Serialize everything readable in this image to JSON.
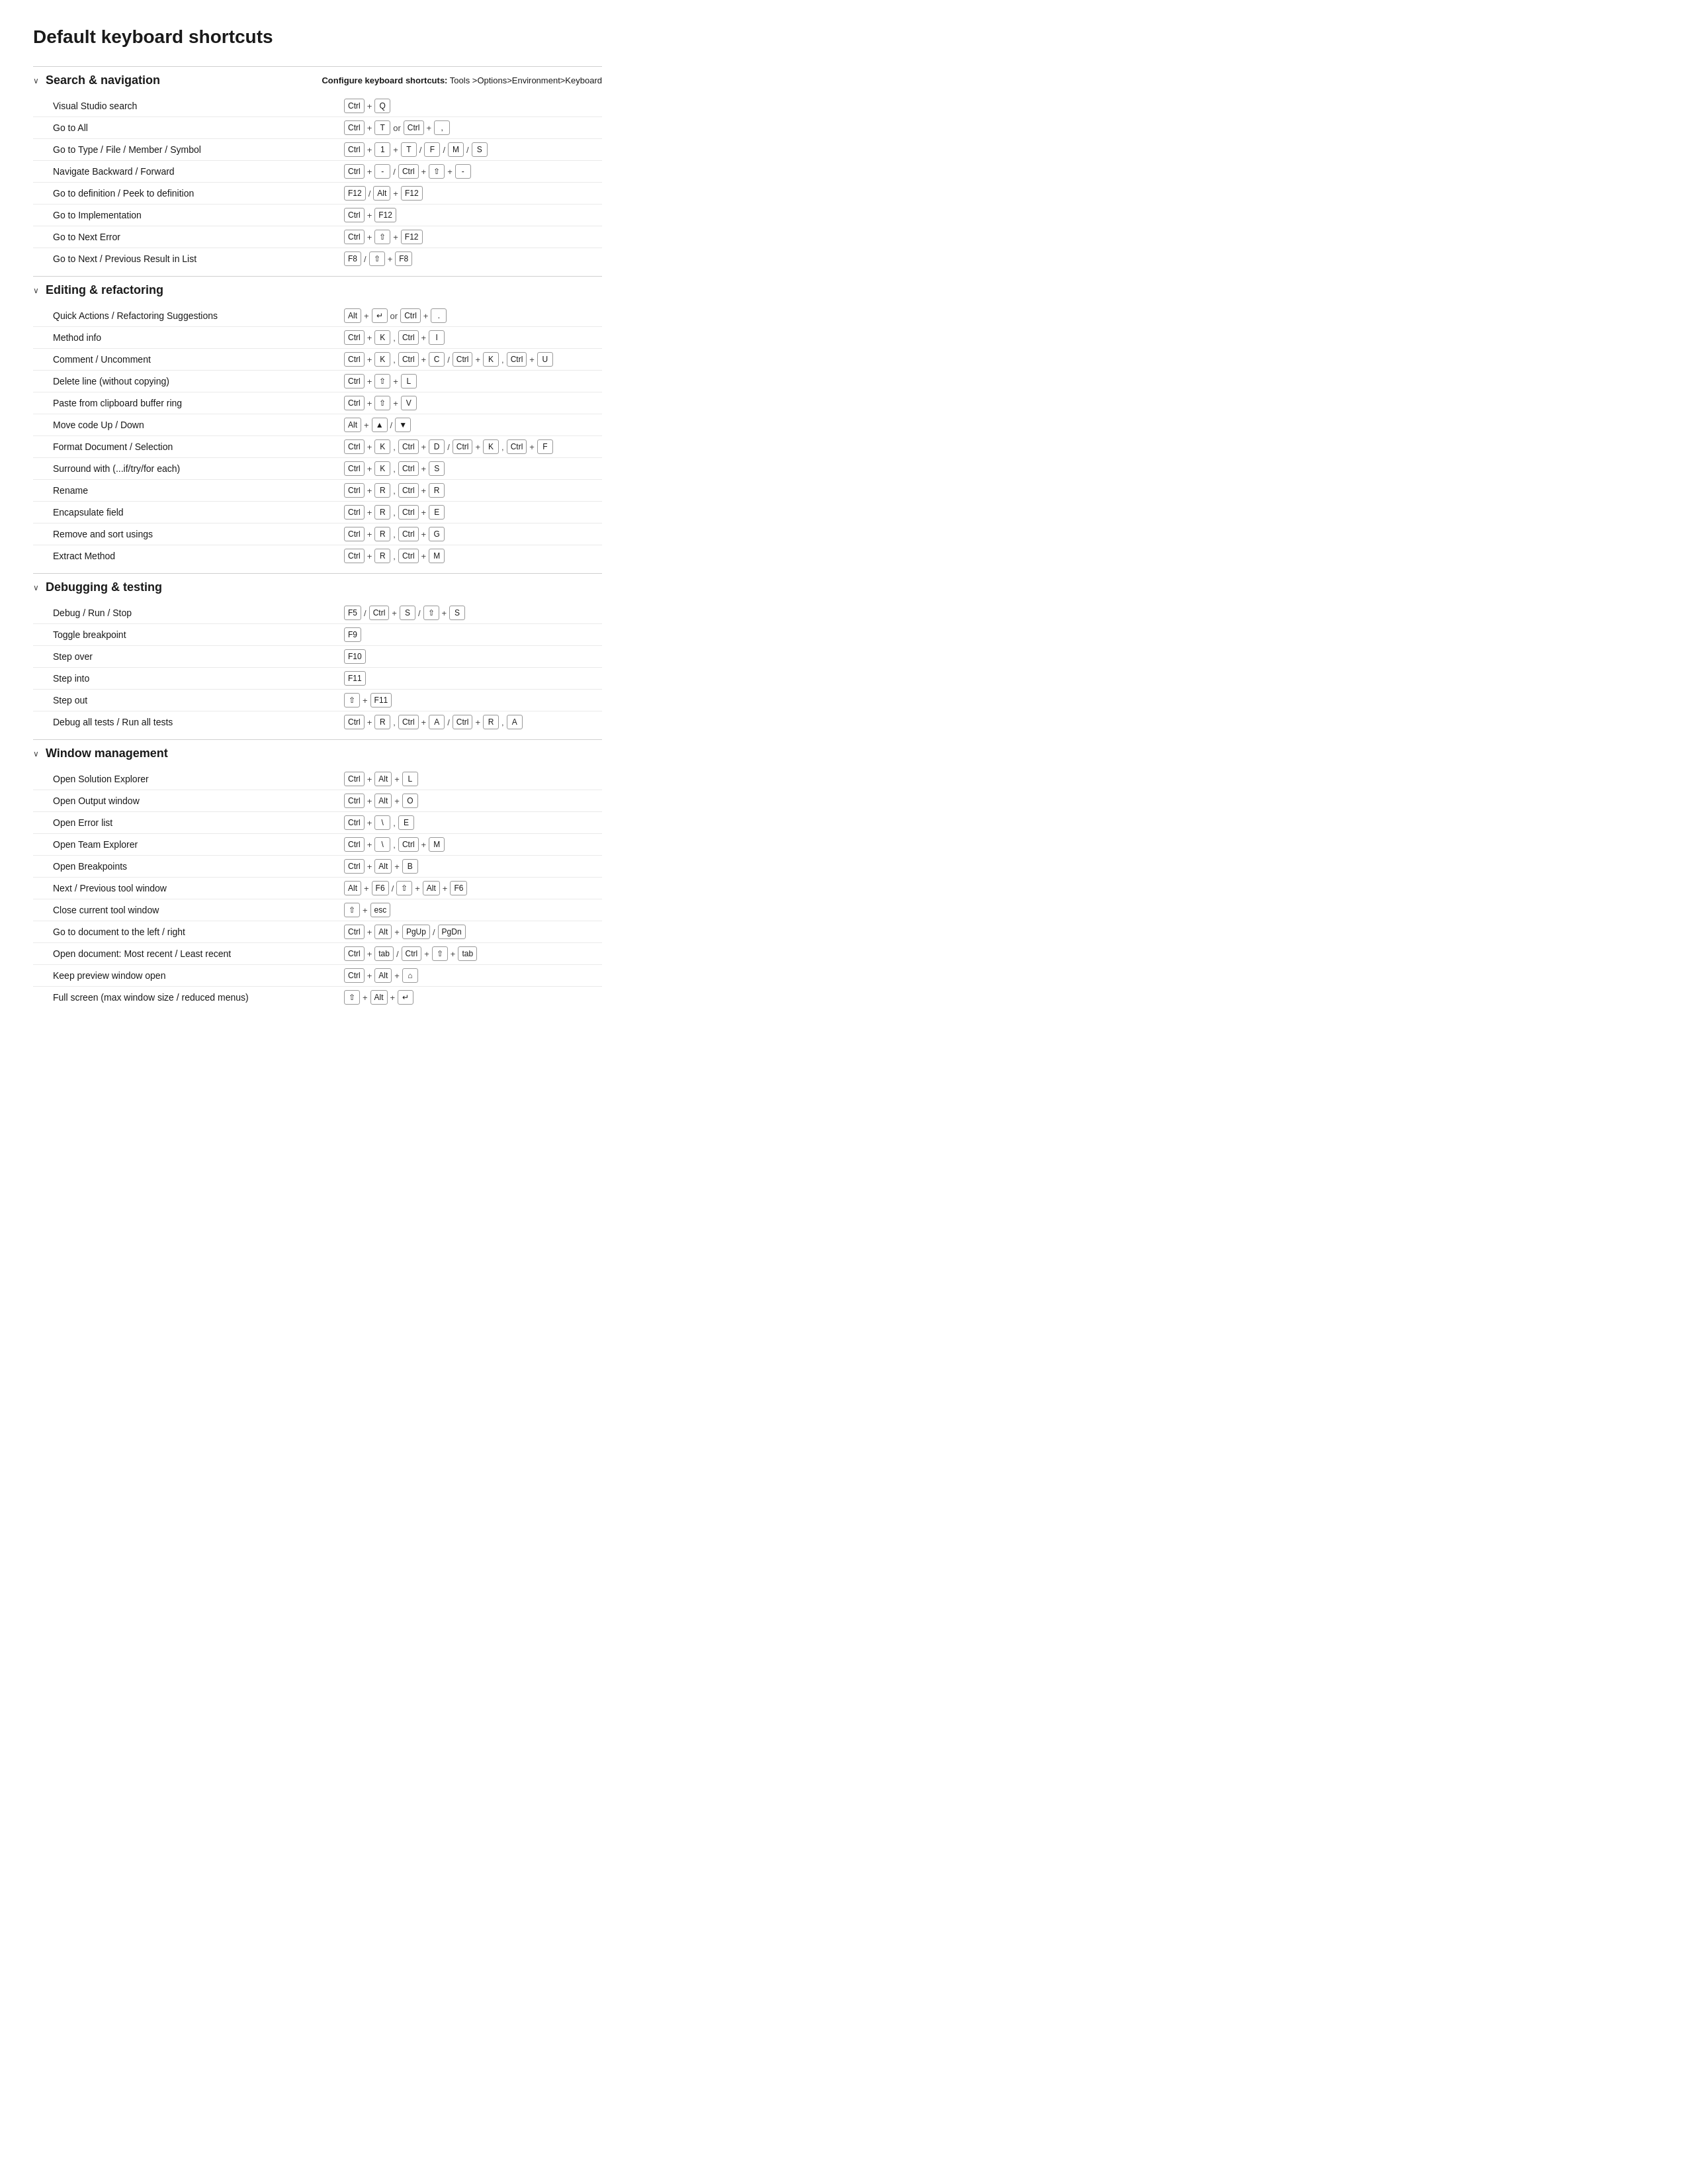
{
  "page": {
    "title": "Default keyboard shortcuts"
  },
  "sections": [
    {
      "id": "search-navigation",
      "label": "Search & navigation",
      "configure_note": "Configure keyboard shortcuts: Tools >Options>Environment>Keyboard",
      "rows": [
        {
          "label": "Visual Studio search",
          "keys_html": "<kbd>Ctrl</kbd><span class='sep'>+</span><kbd>Q</kbd>"
        },
        {
          "label": "Go to All",
          "keys_html": "<kbd>Ctrl</kbd><span class='sep'>+</span><kbd>T</kbd><span class='sep'>or</span><kbd>Ctrl</kbd><span class='sep'>+</span><kbd>,</kbd>"
        },
        {
          "label": "Go to Type / File / Member / Symbol",
          "keys_html": "<kbd>Ctrl</kbd><span class='sep'>+</span><kbd>1</kbd><span class='sep'>+</span><kbd>T</kbd><span class='sep'>/</span><kbd>F</kbd><span class='sep'>/</span><kbd>M</kbd><span class='sep'>/</span><kbd>S</kbd>"
        },
        {
          "label": "Navigate Backward / Forward",
          "keys_html": "<kbd>Ctrl</kbd><span class='sep'>+</span><kbd>-</kbd><span class='sep'>/</span><kbd>Ctrl</kbd><span class='sep'>+</span><kbd>⇧</kbd><span class='sep'>+</span><kbd>-</kbd>"
        },
        {
          "label": "Go to definition / Peek to definition",
          "keys_html": "<kbd>F12</kbd><span class='sep'>/</span><kbd>Alt</kbd><span class='sep'>+</span><kbd>F12</kbd>"
        },
        {
          "label": "Go to Implementation",
          "keys_html": "<kbd>Ctrl</kbd><span class='sep'>+</span><kbd>F12</kbd>"
        },
        {
          "label": "Go to Next Error",
          "keys_html": "<kbd>Ctrl</kbd><span class='sep'>+</span><kbd>⇧</kbd><span class='sep'>+</span><kbd>F12</kbd>"
        },
        {
          "label": "Go to Next / Previous Result in List",
          "keys_html": "<kbd>F8</kbd><span class='sep'>/</span><kbd>⇧</kbd><span class='sep'>+</span><kbd>F8</kbd>"
        }
      ]
    },
    {
      "id": "editing-refactoring",
      "label": "Editing & refactoring",
      "configure_note": "",
      "rows": [
        {
          "label": "Quick Actions / Refactoring Suggestions",
          "keys_html": "<kbd>Alt</kbd><span class='sep'>+</span><kbd>↵</kbd><span class='sep'>or</span><kbd>Ctrl</kbd><span class='sep'>+</span><kbd>.</kbd>"
        },
        {
          "label": "Method info",
          "keys_html": "<kbd>Ctrl</kbd><span class='sep'>+</span><kbd>K</kbd><span class='sep'>,</span><kbd>Ctrl</kbd><span class='sep'>+</span><kbd>I</kbd>"
        },
        {
          "label": "Comment / Uncomment",
          "keys_html": "<kbd>Ctrl</kbd><span class='sep'>+</span><kbd>K</kbd><span class='sep'>,</span><kbd>Ctrl</kbd><span class='sep'>+</span><kbd>C</kbd><span class='sep'>/</span><kbd>Ctrl</kbd><span class='sep'>+</span><kbd>K</kbd><span class='sep'>,</span><kbd>Ctrl</kbd><span class='sep'>+</span><kbd>U</kbd>"
        },
        {
          "label": "Delete line (without copying)",
          "keys_html": "<kbd>Ctrl</kbd><span class='sep'>+</span><kbd>⇧</kbd><span class='sep'>+</span><kbd>L</kbd>"
        },
        {
          "label": "Paste from clipboard buffer ring",
          "keys_html": "<kbd>Ctrl</kbd><span class='sep'>+</span><kbd>⇧</kbd><span class='sep'>+</span><kbd>V</kbd>"
        },
        {
          "label": "Move code Up / Down",
          "keys_html": "<kbd>Alt</kbd><span class='sep'>+</span><kbd>▲</kbd><span class='sep'>/</span><kbd>▼</kbd>"
        },
        {
          "label": "Format Document / Selection",
          "keys_html": "<kbd>Ctrl</kbd><span class='sep'>+</span><kbd>K</kbd><span class='sep'>,</span><kbd>Ctrl</kbd><span class='sep'>+</span><kbd>D</kbd><span class='sep'>/</span><kbd>Ctrl</kbd><span class='sep'>+</span><kbd>K</kbd><span class='sep'>,</span><kbd>Ctrl</kbd><span class='sep'>+</span><kbd>F</kbd>"
        },
        {
          "label": "Surround with (...if/try/for each)",
          "keys_html": "<kbd>Ctrl</kbd><span class='sep'>+</span><kbd>K</kbd><span class='sep'>,</span><kbd>Ctrl</kbd><span class='sep'>+</span><kbd>S</kbd>"
        },
        {
          "label": "Rename",
          "keys_html": "<kbd>Ctrl</kbd><span class='sep'>+</span><kbd>R</kbd><span class='sep'>,</span><kbd>Ctrl</kbd><span class='sep'>+</span><kbd>R</kbd>"
        },
        {
          "label": "Encapsulate field",
          "keys_html": "<kbd>Ctrl</kbd><span class='sep'>+</span><kbd>R</kbd><span class='sep'>,</span><kbd>Ctrl</kbd><span class='sep'>+</span><kbd>E</kbd>"
        },
        {
          "label": "Remove and sort usings",
          "keys_html": "<kbd>Ctrl</kbd><span class='sep'>+</span><kbd>R</kbd><span class='sep'>,</span><kbd>Ctrl</kbd><span class='sep'>+</span><kbd>G</kbd>"
        },
        {
          "label": "Extract Method",
          "keys_html": "<kbd>Ctrl</kbd><span class='sep'>+</span><kbd>R</kbd><span class='sep'>,</span><kbd>Ctrl</kbd><span class='sep'>+</span><kbd>M</kbd>"
        }
      ]
    },
    {
      "id": "debugging-testing",
      "label": "Debugging & testing",
      "configure_note": "",
      "rows": [
        {
          "label": "Debug / Run / Stop",
          "keys_html": "<kbd>F5</kbd><span class='sep'>/</span><kbd>Ctrl</kbd><span class='sep'>+</span><kbd>S</kbd><span class='sep'>/</span><kbd>⇧</kbd><span class='sep'>+</span><kbd>S</kbd>"
        },
        {
          "label": "Toggle breakpoint",
          "keys_html": "<kbd>F9</kbd>"
        },
        {
          "label": "Step over",
          "keys_html": "<kbd>F10</kbd>"
        },
        {
          "label": "Step into",
          "keys_html": "<kbd>F11</kbd>"
        },
        {
          "label": "Step out",
          "keys_html": "<kbd>⇧</kbd><span class='sep'>+</span><kbd>F11</kbd>"
        },
        {
          "label": "Debug all tests / Run all tests",
          "keys_html": "<kbd>Ctrl</kbd><span class='sep'>+</span><kbd>R</kbd><span class='sep'>,</span><kbd>Ctrl</kbd><span class='sep'>+</span><kbd>A</kbd><span class='sep'>/</span><kbd>Ctrl</kbd><span class='sep'>+</span><kbd>R</kbd><span class='sep'>,</span><kbd>A</kbd>"
        }
      ]
    },
    {
      "id": "window-management",
      "label": "Window management",
      "configure_note": "",
      "rows": [
        {
          "label": "Open Solution Explorer",
          "keys_html": "<kbd>Ctrl</kbd><span class='sep'>+</span><kbd>Alt</kbd><span class='sep'>+</span><kbd>L</kbd>"
        },
        {
          "label": "Open Output window",
          "keys_html": "<kbd>Ctrl</kbd><span class='sep'>+</span><kbd>Alt</kbd><span class='sep'>+</span><kbd>O</kbd>"
        },
        {
          "label": "Open Error list",
          "keys_html": "<kbd>Ctrl</kbd><span class='sep'>+</span><kbd>\\</kbd><span class='sep'>,</span><kbd>E</kbd>"
        },
        {
          "label": "Open Team Explorer",
          "keys_html": "<kbd>Ctrl</kbd><span class='sep'>+</span><kbd>\\</kbd><span class='sep'>,</span><kbd>Ctrl</kbd><span class='sep'>+</span><kbd>M</kbd>"
        },
        {
          "label": "Open Breakpoints",
          "keys_html": "<kbd>Ctrl</kbd><span class='sep'>+</span><kbd>Alt</kbd><span class='sep'>+</span><kbd>B</kbd>"
        },
        {
          "label": "Next / Previous tool window",
          "keys_html": "<kbd>Alt</kbd><span class='sep'>+</span><kbd>F6</kbd><span class='sep'>/</span><kbd>⇧</kbd><span class='sep'>+</span><kbd>Alt</kbd><span class='sep'>+</span><kbd>F6</kbd>"
        },
        {
          "label": "Close current tool window",
          "keys_html": "<kbd>⇧</kbd><span class='sep'>+</span><kbd>esc</kbd>"
        },
        {
          "label": "Go to document to the left / right",
          "keys_html": "<kbd>Ctrl</kbd><span class='sep'>+</span><kbd>Alt</kbd><span class='sep'>+</span><kbd>PgUp</kbd><span class='sep'>/</span><kbd>PgDn</kbd>"
        },
        {
          "label": "Open document:  Most recent / Least recent",
          "keys_html": "<kbd>Ctrl</kbd><span class='sep'>+</span><kbd>tab</kbd><span class='sep'>/</span><kbd>Ctrl</kbd><span class='sep'>+</span><kbd>⇧</kbd><span class='sep'>+</span><kbd>tab</kbd>"
        },
        {
          "label": "Keep preview window open",
          "keys_html": "<kbd>Ctrl</kbd><span class='sep'>+</span><kbd>Alt</kbd><span class='sep'>+</span><kbd>⌂</kbd>"
        },
        {
          "label": "Full screen (max window size / reduced menus)",
          "keys_html": "<kbd>⇧</kbd><span class='sep'>+</span><kbd>Alt</kbd><span class='sep'>+</span><kbd>↵</kbd>"
        }
      ]
    }
  ]
}
